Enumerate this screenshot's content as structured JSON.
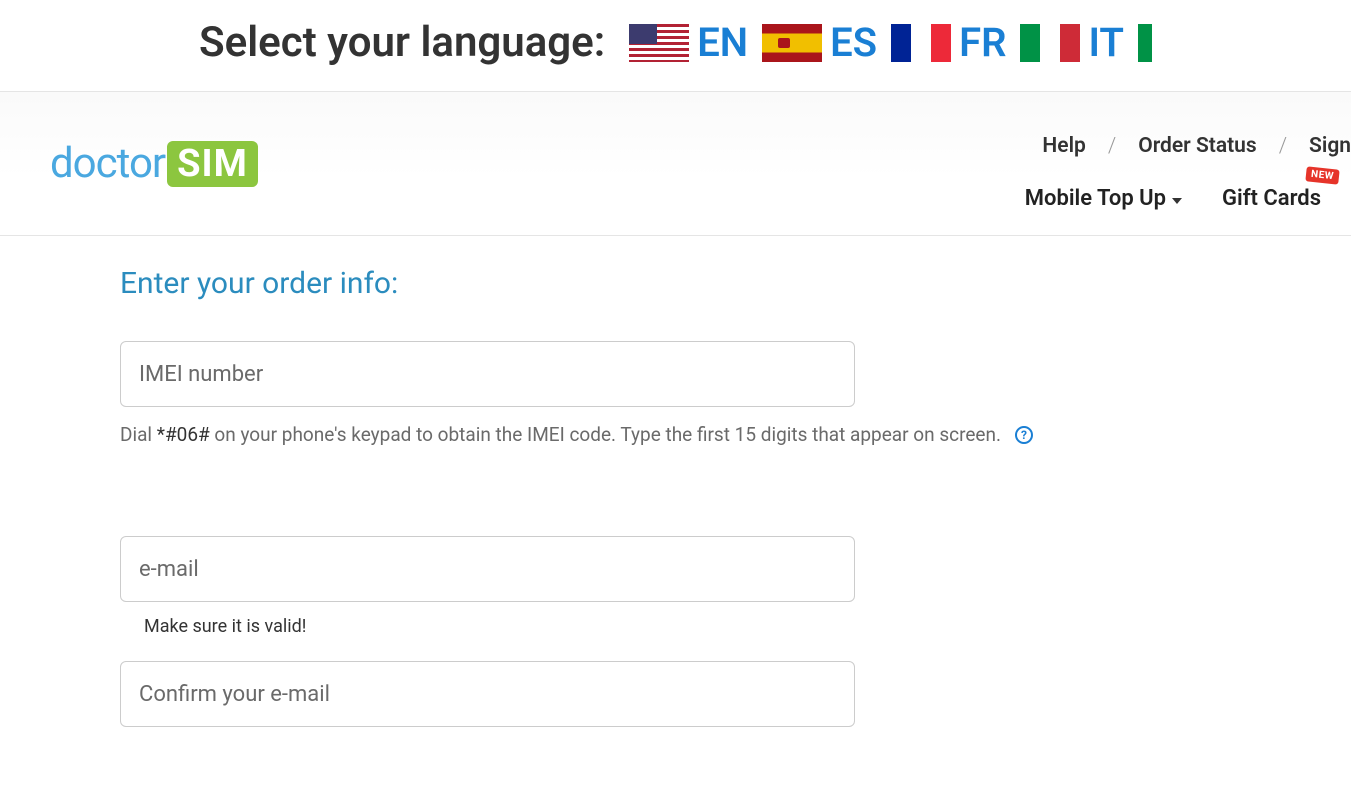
{
  "langbar": {
    "title": "Select your language:",
    "items": [
      {
        "code": "EN",
        "flag": "us"
      },
      {
        "code": "ES",
        "flag": "es"
      },
      {
        "code": "FR",
        "flag": "fr"
      },
      {
        "code": "IT",
        "flag": "it"
      }
    ]
  },
  "logo": {
    "part1": "doctor",
    "part2": "SIM"
  },
  "nav": {
    "top": {
      "help": "Help",
      "order_status": "Order Status",
      "sign": "Sign"
    },
    "bottom": {
      "topup": "Mobile Top Up",
      "giftcards": "Gift Cards",
      "badge_new": "NEW"
    }
  },
  "form": {
    "title": "Enter your order info:",
    "imei_placeholder": "IMEI number",
    "imei_hint_prefix": "Dial ",
    "imei_hint_code": "*#06#",
    "imei_hint_suffix": " on your phone's keypad to obtain the IMEI code. Type the first 15 digits that appear on screen.",
    "help_icon": "?",
    "email_placeholder": "e-mail",
    "email_hint": "Make sure it is valid!",
    "confirm_email_placeholder": "Confirm your e-mail"
  }
}
